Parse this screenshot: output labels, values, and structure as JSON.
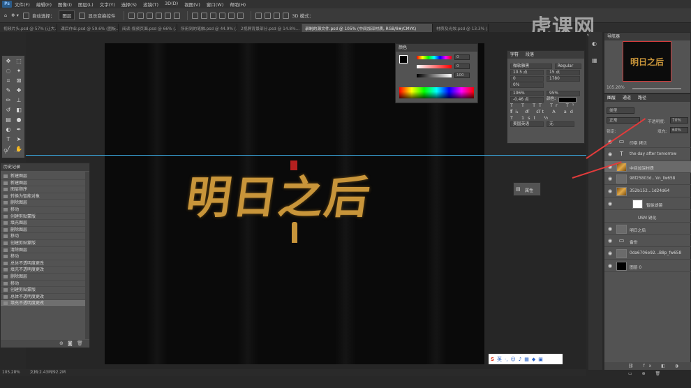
{
  "menubar": {
    "items": [
      "文件(F)",
      "编辑(E)",
      "图像(I)",
      "图层(L)",
      "文字(Y)",
      "选择(S)",
      "滤镜(T)",
      "3D(D)",
      "视图(V)",
      "窗口(W)",
      "帮助(H)"
    ]
  },
  "options": {
    "auto_select": "自动选择：",
    "mode": "图层",
    "transform": "显示变换控件",
    "extra": "3D 模式："
  },
  "tabs": [
    "视频片头.psd @ 57% (让大...",
    "课后作业.psd @ 59.6% (图板...",
    "阅读-视频页面.psd @ 66% (...",
    "所用到的笔触.psd @ 44.9% (...",
    "2视屏背景部分.psd @ 14.8%...",
    "录制的源文件.psd @ 105% (中间加深材质, RGB/8#/CMYK)",
    "材质及光效.psd @ 13.3% (..."
  ],
  "active_tab": 5,
  "watermark": "虎课网",
  "canvas_title": "明日之后",
  "history": {
    "title": "历史记录",
    "items": [
      "新建图层",
      "新建图层",
      "图层顺序",
      "转换为智能对象",
      "删除图层",
      "移动",
      "创建剪贴蒙版",
      "填充图层",
      "删除图层",
      "移动",
      "创建剪贴蒙版",
      "清除图层",
      "移动",
      "总体不透明度更改",
      "填充不透明度更改",
      "删除图层",
      "移动",
      "创建剪贴蒙版",
      "总体不透明度更改",
      "填充不透明度更改"
    ],
    "selected": 19
  },
  "color_panel": {
    "title": "颜色",
    "values": [
      "0",
      "0",
      "100"
    ]
  },
  "char_panel": {
    "tabs": [
      "字符",
      "段落"
    ],
    "font": "微软雅黑",
    "style": "Regular",
    "size": "10.5 点",
    "leading": "15 点",
    "tracking": "1780",
    "kerning": "0",
    "scale_pct": "0%",
    "vscale": "106%",
    "hscale": "95%",
    "baseline": "-0.46 点",
    "color_label": "颜色:",
    "lang": "美国英语",
    "aa": "无"
  },
  "attributes": {
    "label": "属性"
  },
  "navigator": {
    "title": "导航器",
    "zoom": "105.28%"
  },
  "layers": {
    "tabs": [
      "图层",
      "通道",
      "路径"
    ],
    "kind": "类型",
    "blend": "正常",
    "opacity_label": "不透明度:",
    "opacity": "70%",
    "lock_label": "锁定:",
    "fill_label": "填充:",
    "fill": "60%",
    "rows": [
      {
        "name": "印章 拷贝",
        "type": "folder"
      },
      {
        "name": "the day after tomorrow",
        "type": "text"
      },
      {
        "name": "中间加深材质",
        "type": "gold",
        "selected": true
      },
      {
        "name": "98f25803d...Vn_fw658",
        "type": "image"
      },
      {
        "name": "352b152...1d24d64",
        "type": "gold"
      },
      {
        "name": "智能滤镜",
        "type": "white"
      },
      {
        "name": "USM 锐化",
        "type": "none"
      },
      {
        "name": "明日之后",
        "type": "image"
      },
      {
        "name": "备份",
        "type": "folder"
      },
      {
        "name": "0da6706e92...B8p_fw658",
        "type": "image"
      },
      {
        "name": "图层 0",
        "type": "black"
      }
    ]
  },
  "status": {
    "zoom": "105.28%",
    "doc": "文档:2.43M/92.2M"
  },
  "ime": {
    "label": "英"
  },
  "colors": {
    "bg": "#282828",
    "panel": "#535353",
    "accent": "#3ba8e0",
    "gold": "#c8953a",
    "arrow": "#e23b3b"
  }
}
